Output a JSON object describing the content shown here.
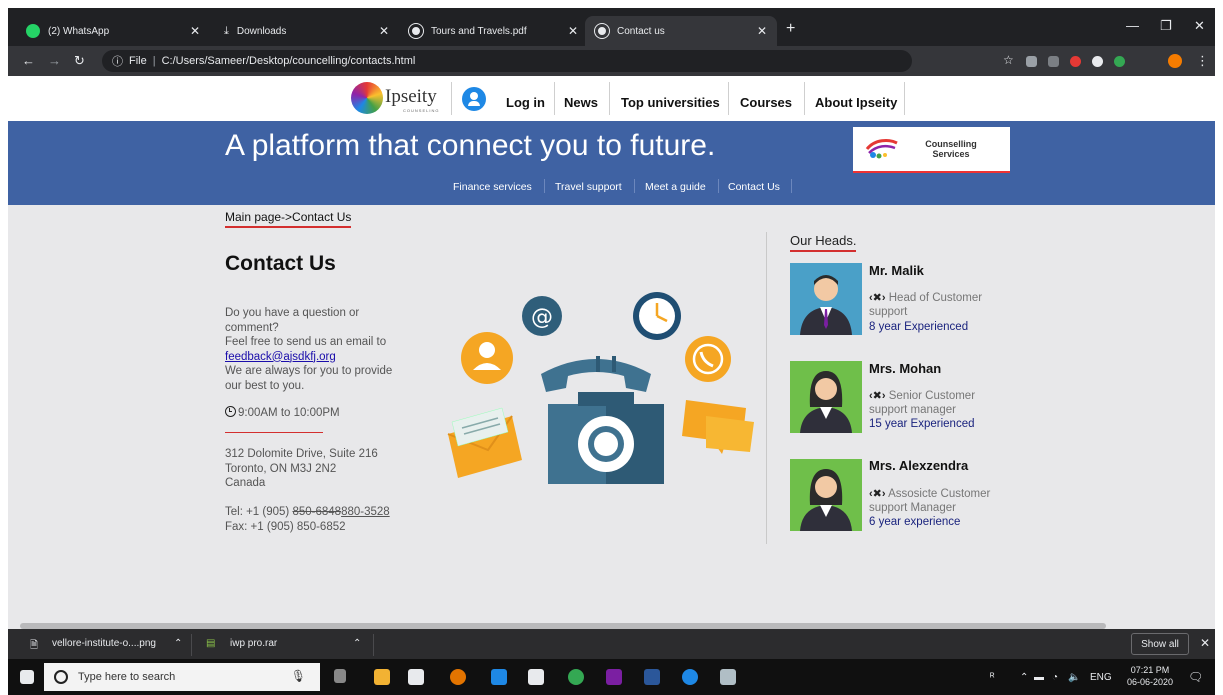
{
  "browser": {
    "tabs": [
      {
        "title": "(2) WhatsApp",
        "color": "#25d366"
      },
      {
        "title": "Downloads",
        "color": "#e8eaed"
      },
      {
        "title": "Tours and Travels.pdf",
        "color": "#e8eaed"
      },
      {
        "title": "Contact us",
        "color": "#e8eaed"
      }
    ],
    "url_scheme": "File",
    "url": "C:/Users/Sameer/Desktop/councelling/contacts.html"
  },
  "site": {
    "logo_text": "Ipseity",
    "logo_sub": "COUNSELING",
    "nav": [
      "Log in",
      "News",
      "Top universities",
      "Courses",
      "About Ipseity"
    ],
    "banner_title": "A platform that connect you to future.",
    "cs_logo_line1": "Counselling",
    "cs_logo_line2": "Services",
    "banner_links": [
      "Finance services",
      "Travel support",
      "Meet a guide",
      "Contact Us"
    ],
    "breadcrumb": "Main page->Contact Us"
  },
  "contact": {
    "title": "Contact Us",
    "intro_line1": "Do you have a question or",
    "intro_line2": "comment?",
    "intro_line3": "Feel free to send us an email to",
    "email": "feedback@ajsdkfj.org",
    "intro_line4": "We are always for you to provide",
    "intro_line5": "our best to you.",
    "hours": "9:00AM to 10:00PM",
    "addr1": "312 Dolomite Drive, Suite 216",
    "addr2": "Toronto, ON M3J 2N2",
    "addr3": "Canada",
    "tel_prefix": "Tel: +1 (905) ",
    "tel_old": "850-6848",
    "tel_new": "880-3528",
    "fax": "Fax: +1 (905) 850-6852"
  },
  "heads": {
    "title": "Our Heads.",
    "people": [
      {
        "name": "Mr. Malik",
        "role1": "Head of Customer",
        "role2": "support",
        "experience": "8 year Experienced"
      },
      {
        "name": "Mrs. Mohan",
        "role1": "Senior Customer",
        "role2": "support manager",
        "experience": "15 year Experienced"
      },
      {
        "name": "Mrs. Alexzendra",
        "role1": "Assosicte Customer",
        "role2": "support Manager",
        "experience": "6 year experience"
      }
    ]
  },
  "downloads": {
    "items": [
      "vellore-institute-o....png",
      "iwp pro.rar"
    ],
    "show_all": "Show all"
  },
  "taskbar": {
    "search_placeholder": "Type here to search",
    "lang": "ENG",
    "time": "07:21 PM",
    "date": "06-06-2020"
  }
}
